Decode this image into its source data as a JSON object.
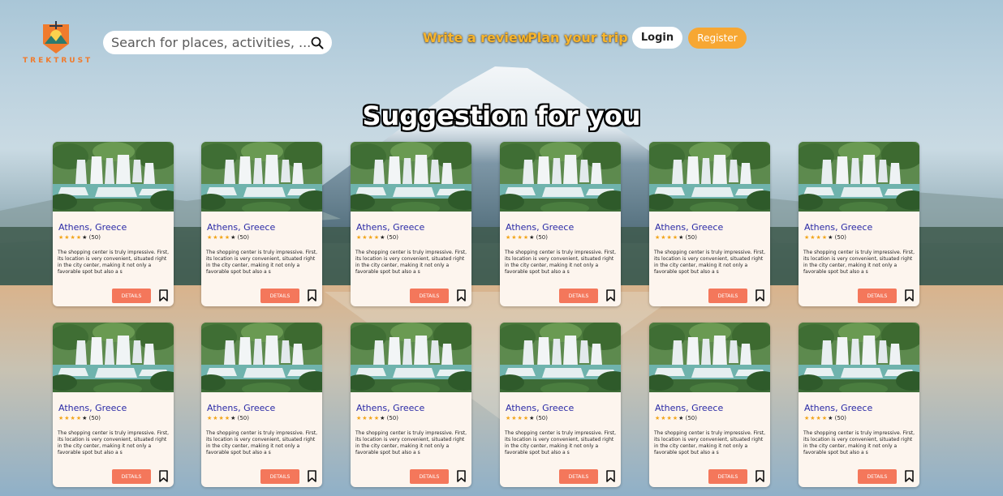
{
  "brand": {
    "name": "TREKTRUST"
  },
  "search": {
    "placeholder": "Search for places, activities, ..."
  },
  "nav": {
    "write_review": "Write a review",
    "plan_trip": "Plan your trip"
  },
  "auth": {
    "login": "Login",
    "register": "Register"
  },
  "main": {
    "title": "Suggestion for you"
  },
  "colors": {
    "accent": "#f7a733",
    "details_button": "#f4775b",
    "card_title": "#2a2aa6",
    "brand": "#f07b2d"
  },
  "cards": [
    {
      "title": "Athens, Greece",
      "stars": "★★★★",
      "last_star": "★",
      "rating": "(50)",
      "description": "The shopping center is truly impressive. First, its location is very convenient, situated right in the city center, making it not only a favorable spot but also a s",
      "button": "DETAILS"
    },
    {
      "title": "Athens, Greece",
      "stars": "★★★★",
      "last_star": "★",
      "rating": "(50)",
      "description": "The shopping center is truly impressive. First, its location is very convenient, situated right in the city center, making it not only a favorable spot but also a s",
      "button": "DETAILS"
    },
    {
      "title": "Athens, Greece",
      "stars": "★★★★",
      "last_star": "★",
      "rating": "(50)",
      "description": "The shopping center is truly impressive. First, its location is very convenient, situated right in the city center, making it not only a favorable spot but also a s",
      "button": "DETAILS"
    },
    {
      "title": "Athens, Greece",
      "stars": "★★★★",
      "last_star": "★",
      "rating": "(50)",
      "description": "The shopping center is truly impressive. First, its location is very convenient, situated right in the city center, making it not only a favorable spot but also a s",
      "button": "DETAILS"
    },
    {
      "title": "Athens, Greece",
      "stars": "★★★★",
      "last_star": "★",
      "rating": "(50)",
      "description": "The shopping center is truly impressive. First, its location is very convenient, situated right in the city center, making it not only a favorable spot but also a s",
      "button": "DETAILS"
    },
    {
      "title": "Athens, Greece",
      "stars": "★★★★",
      "last_star": "★",
      "rating": "(50)",
      "description": "The shopping center is truly impressive. First, its location is very convenient, situated right in the city center, making it not only a favorable spot but also a s",
      "button": "DETAILS"
    },
    {
      "title": "Athens, Greece",
      "stars": "★★★★",
      "last_star": "★",
      "rating": "(50)",
      "description": "The shopping center is truly impressive. First, its location is very convenient, situated right in the city center, making it not only a favorable spot but also a s",
      "button": "DETAILS"
    },
    {
      "title": "Athens, Greece",
      "stars": "★★★★",
      "last_star": "★",
      "rating": "(50)",
      "description": "The shopping center is truly impressive. First, its location is very convenient, situated right in the city center, making it not only a favorable spot but also a s",
      "button": "DETAILS"
    },
    {
      "title": "Athens, Greece",
      "stars": "★★★★",
      "last_star": "★",
      "rating": "(50)",
      "description": "The shopping center is truly impressive. First, its location is very convenient, situated right in the city center, making it not only a favorable spot but also a s",
      "button": "DETAILS"
    },
    {
      "title": "Athens, Greece",
      "stars": "★★★★",
      "last_star": "★",
      "rating": "(50)",
      "description": "The shopping center is truly impressive. First, its location is very convenient, situated right in the city center, making it not only a favorable spot but also a s",
      "button": "DETAILS"
    },
    {
      "title": "Athens, Greece",
      "stars": "★★★★",
      "last_star": "★",
      "rating": "(50)",
      "description": "The shopping center is truly impressive. First, its location is very convenient, situated right in the city center, making it not only a favorable spot but also a s",
      "button": "DETAILS"
    },
    {
      "title": "Athens, Greece",
      "stars": "★★★★",
      "last_star": "★",
      "rating": "(50)",
      "description": "The shopping center is truly impressive. First, its location is very convenient, situated right in the city center, making it not only a favorable spot but also a s",
      "button": "DETAILS"
    }
  ]
}
